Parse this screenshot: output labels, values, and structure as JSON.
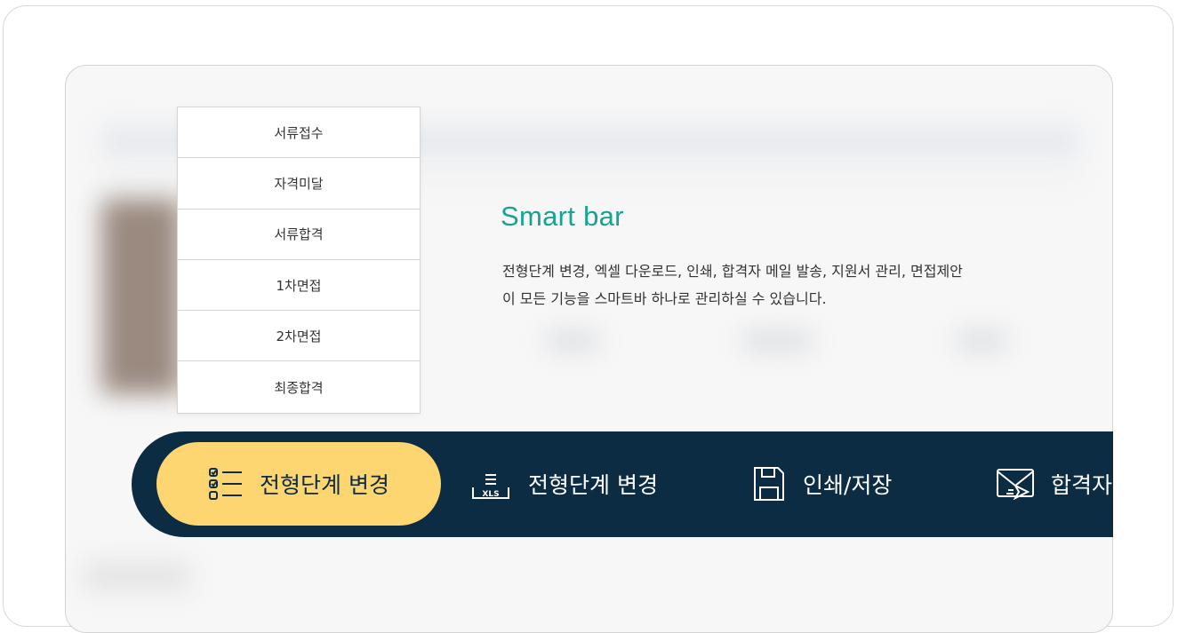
{
  "stages": [
    "서류접수",
    "자격미달",
    "서류합격",
    "1차면접",
    "2차면접",
    "최종합격"
  ],
  "feature": {
    "title": "Smart bar",
    "description_line1": "전형단계 변경, 엑셀 다운로드, 인쇄, 합격자 메일 발송, 지원서 관리, 면접제안",
    "description_line2": "이 모든 기능을 스마트바 하나로 관리하실 수 있습니다."
  },
  "smartbar": {
    "items": [
      {
        "label": "전형단계 변경",
        "icon": "checklist-icon",
        "active": true
      },
      {
        "label": "전형단계 변경",
        "icon": "xls-icon",
        "icon_text": "XLS",
        "active": false
      },
      {
        "label": "인쇄/저장",
        "icon": "save-icon",
        "active": false
      },
      {
        "label": "합격자",
        "icon": "mail-send-icon",
        "active": false
      }
    ]
  },
  "colors": {
    "accent_teal": "#16a392",
    "bar_navy": "#0c2c43",
    "active_yellow": "#fdd571"
  }
}
